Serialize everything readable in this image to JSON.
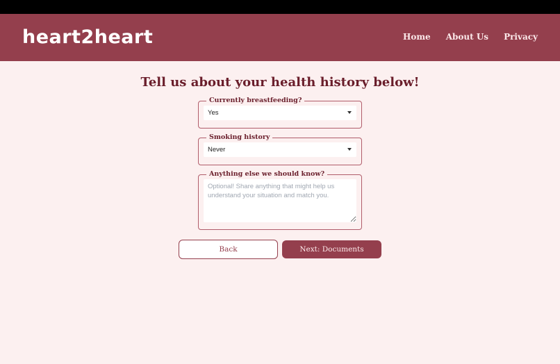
{
  "header": {
    "logo": "heart2heart",
    "nav": [
      {
        "label": "Home"
      },
      {
        "label": "About Us"
      },
      {
        "label": "Privacy"
      }
    ]
  },
  "page": {
    "title": "Tell us about your health history below!"
  },
  "form": {
    "breastfeeding": {
      "label": "Currently breastfeeding?",
      "value": "Yes"
    },
    "smoking": {
      "label": "Smoking history",
      "value": "Never"
    },
    "notes": {
      "label": "Anything else we should know?",
      "placeholder": "Optional! Share anything that might help us understand your situation and match you.",
      "value": ""
    }
  },
  "actions": {
    "back_label": "Back",
    "next_label": "Next: Documents"
  },
  "colors": {
    "brand": "#943f4d",
    "background": "#fcf0f0",
    "heading": "#6a1e2b"
  }
}
